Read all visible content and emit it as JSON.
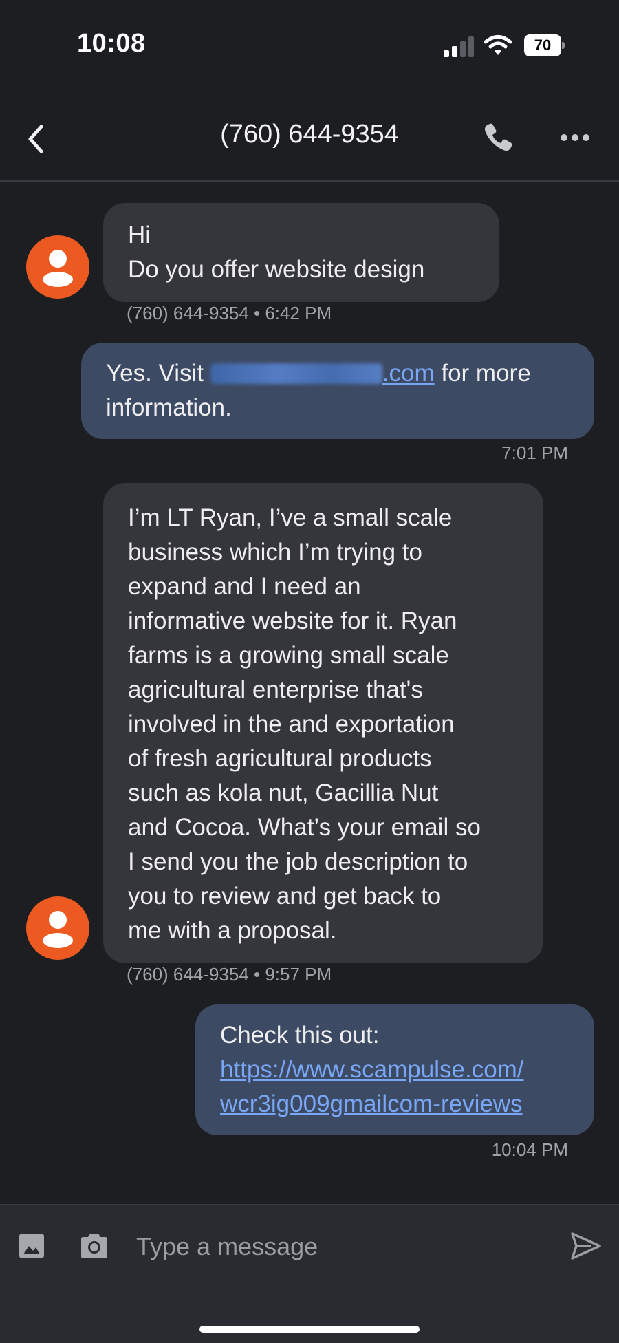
{
  "status_bar": {
    "time": "10:08",
    "battery": "70"
  },
  "header": {
    "title": "(760) 644-9354",
    "back_icon": "chevron-left-icon",
    "call_icon": "phone-icon",
    "more_icon": "more-horizontal-icon"
  },
  "messages": [
    {
      "direction": "incoming",
      "lines": [
        "Hi",
        "Do you offer website design"
      ],
      "meta": "(760) 644-9354 • 6:42 PM"
    },
    {
      "direction": "outgoing",
      "line1_prefix": "Yes. Visit ",
      "link_suffix": ".com",
      "line1_suffix": " for more",
      "line2": "information.",
      "meta": "7:01 PM"
    },
    {
      "direction": "incoming",
      "lines": [
        "I’m LT Ryan, I’ve a small scale",
        "business which I’m trying to",
        "expand and I need an",
        "informative website for it. Ryan",
        "farms is a growing small scale",
        "agricultural enterprise that's",
        "involved in the and exportation",
        "of fresh agricultural products",
        "such as kola nut, Gacillia Nut",
        "and Cocoa. What’s your email so",
        "I send you the job description to",
        "you to review and get back to",
        "me with a proposal."
      ],
      "meta": "(760) 644-9354 • 9:57 PM"
    },
    {
      "direction": "outgoing",
      "text": "Check this out:",
      "link_lines": [
        "https://www.scampulse.com/",
        "wcr3ig009gmailcom-reviews"
      ],
      "meta": "10:04 PM"
    }
  ],
  "composer": {
    "placeholder": "Type a message",
    "value": "",
    "gallery_icon": "image-icon",
    "camera_icon": "camera-icon",
    "send_icon": "send-icon"
  },
  "colors": {
    "background": "#1d1e22",
    "incoming_bubble": "#35363b",
    "outgoing_bubble": "#3d4a63",
    "avatar": "#ec5a22",
    "link": "#79a6f5"
  }
}
